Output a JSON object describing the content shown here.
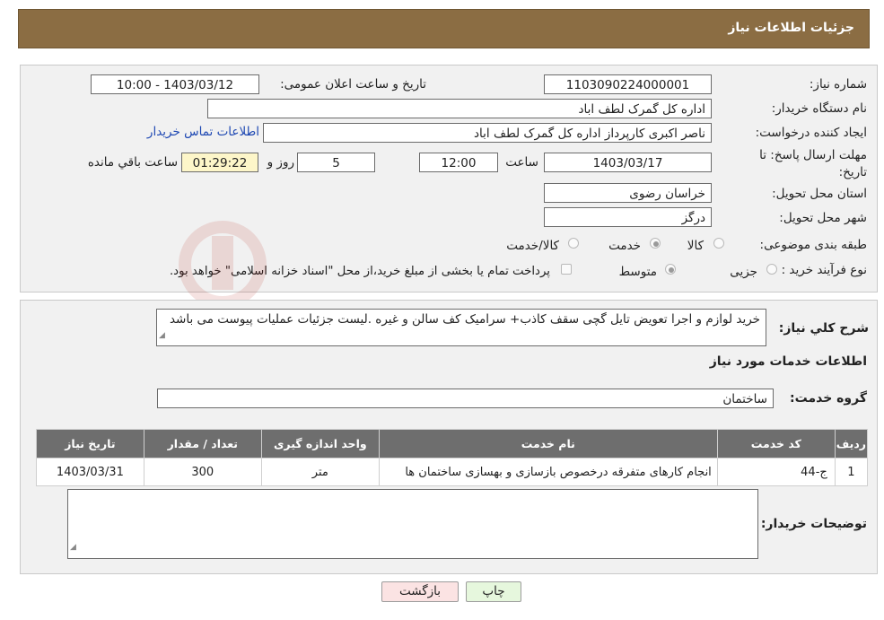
{
  "header": {
    "title": "جزئیات اطلاعات نیاز"
  },
  "form": {
    "need_number_label": "شماره نیاز:",
    "need_number": "1103090224000001",
    "announce_label": "تاریخ و ساعت اعلان عمومی:",
    "announce_value": "1403/03/12 - 10:00",
    "buyer_org_label": "نام دستگاه خریدار:",
    "buyer_org": "اداره کل گمرک لطف اباد",
    "creator_label": "ایجاد کننده درخواست:",
    "creator": "ناصر اکبری کارپرداز اداره کل گمرک لطف اباد",
    "contact_link": "اطلاعات تماس خریدار",
    "deadline_label_1": "مهلت ارسال پاسخ: تا",
    "deadline_label_2": "تاریخ:",
    "deadline_date": "1403/03/17",
    "time_label": "ساعت",
    "deadline_time": "12:00",
    "days_value": "5",
    "days_label": "روز و",
    "remaining_time": "01:29:22",
    "remaining_label": "ساعت باقي مانده",
    "province_label": "استان محل تحویل:",
    "province": "خراسان رضوی",
    "city_label": "شهر محل تحویل:",
    "city": "درگز",
    "category_label": "طبقه بندی موضوعی:",
    "category_options": [
      "کالا",
      "خدمت",
      "کالا/خدمت"
    ],
    "process_label": "نوع فرآیند خرید :",
    "process_options": [
      "جزیی",
      "متوسط"
    ],
    "payment_note": "پرداخت تمام یا بخشی از مبلغ خرید،از محل \"اسناد خزانه اسلامی\" خواهد بود."
  },
  "details": {
    "description_label": "شرح کلي نياز:",
    "description": "خرید لوازم و اجرا تعویض تایل گچی سقف کاذب+ سرامیک کف سالن و غیره .لیست جزئیات عملیات پیوست می باشد",
    "services_title": "اطلاعات خدمات مورد نیاز",
    "service_group_label": "گروه خدمت:",
    "service_group": "ساختمان",
    "table_headers": [
      "ردیف",
      "کد خدمت",
      "نام خدمت",
      "واحد اندازه گیری",
      "تعداد / مقدار",
      "تاریخ نیاز"
    ],
    "table_rows": [
      [
        "1",
        "ج-44",
        "انجام کارهای متفرقه درخصوص بازسازی و بهسازی ساختمان ها",
        "متر",
        "300",
        "1403/03/31"
      ]
    ],
    "buyer_notes_label": "توضیحات خریدار:",
    "buyer_notes": ""
  },
  "buttons": {
    "print": "چاپ",
    "back": "بازگشت"
  },
  "colors": {
    "header_bg": "#8b6d43",
    "link": "#1e48b3",
    "table_header_bg": "#6e6e6e",
    "back_button_bg": "#fbe3e3",
    "print_button_bg": "#e6f7dd"
  }
}
